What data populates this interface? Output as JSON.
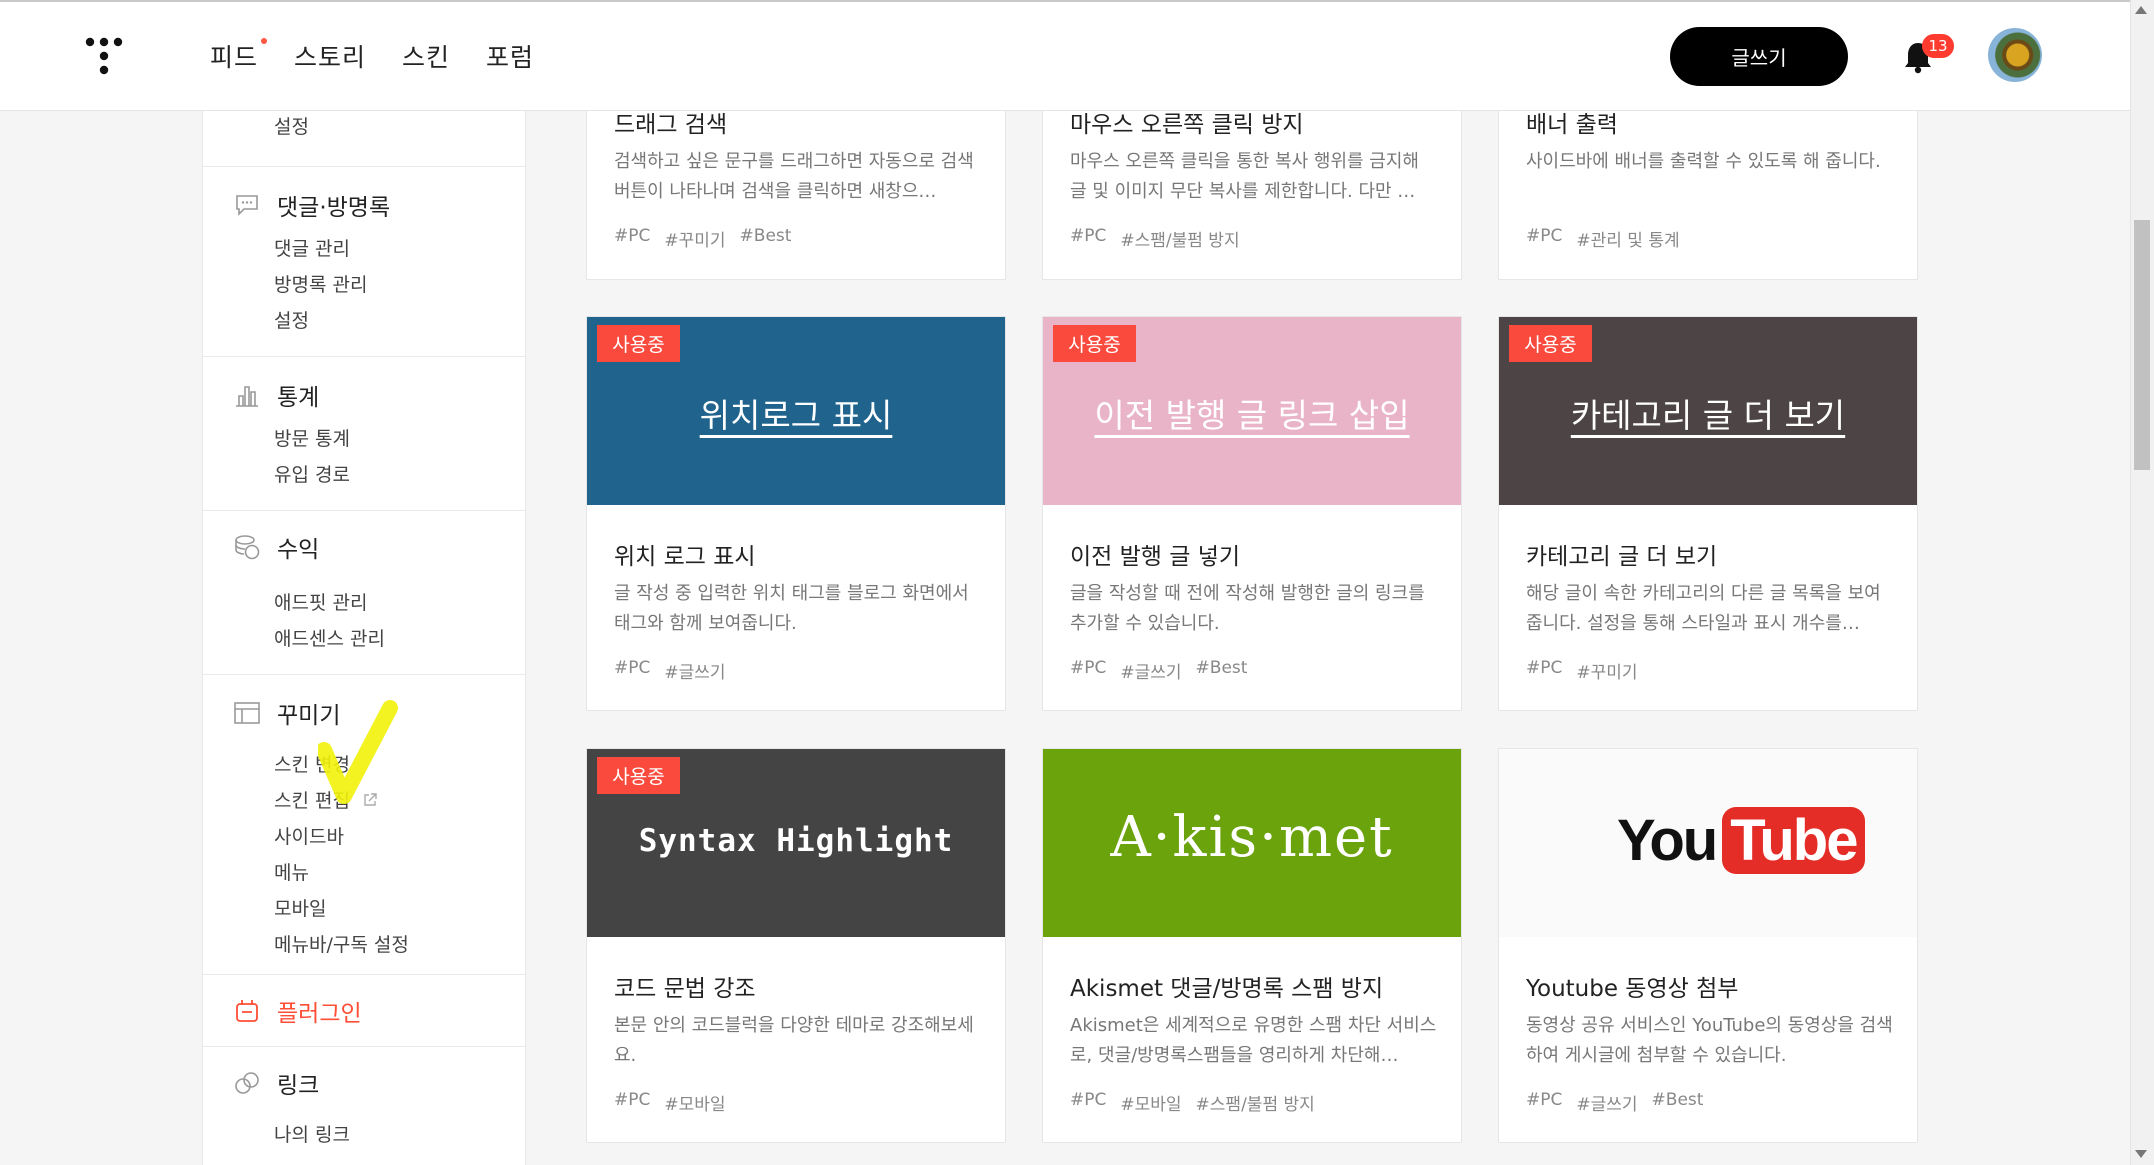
{
  "nav": {
    "items": [
      "피드",
      "스토리",
      "스킨",
      "포럼"
    ],
    "write_button": "글쓰기",
    "notification_count": "13"
  },
  "sidebar": {
    "top_item": "설정",
    "sections": [
      {
        "title": "댓글·방명록",
        "icon": "speech-bubble-icon",
        "items": [
          "댓글 관리",
          "방명록 관리",
          "설정"
        ]
      },
      {
        "title": "통계",
        "icon": "bar-chart-icon",
        "items": [
          "방문 통계",
          "유입 경로"
        ]
      },
      {
        "title": "수익",
        "icon": "coins-icon",
        "items": [
          "애드핏 관리",
          "애드센스 관리"
        ]
      },
      {
        "title": "꾸미기",
        "icon": "layout-icon",
        "items": [
          "스킨 변경",
          "스킨 편집",
          "사이드바",
          "메뉴",
          "모바일",
          "메뉴바/구독 설정"
        ]
      },
      {
        "title": "플러그인",
        "icon": "plugin-icon",
        "items": []
      },
      {
        "title": "링크",
        "icon": "link-icon",
        "items": [
          "나의 링크"
        ]
      }
    ]
  },
  "cards": [
    {
      "title": "드래그 검색",
      "desc": "검색하고 싶은 문구를 드래그하면 자동으로 검색 버튼이 나타나며 검색을 클릭하면 새창으…",
      "tags": [
        "#PC",
        "#꾸미기",
        "#Best"
      ]
    },
    {
      "title": "마우스 오른쪽 클릭 방지",
      "desc": "마우스 오른쪽 클릭을 통한 복사 행위를 금지해 글 및 이미지 무단 복사를 제한합니다. 다만 …",
      "tags": [
        "#PC",
        "#스팸/불펌 방지"
      ]
    },
    {
      "title": "배너 출력",
      "desc": "사이드바에 배너를 출력할 수 있도록 해 줍니다.",
      "tags": [
        "#PC",
        "#관리 및 통계"
      ]
    },
    {
      "badge": "사용중",
      "thumb_label": "위치로그 표시",
      "thumb_color": "#20648e",
      "title": "위치 로그 표시",
      "desc": "글 작성 중 입력한 위치 태그를 블로그 화면에서 태그와 함께 보여줍니다.",
      "tags": [
        "#PC",
        "#글쓰기"
      ]
    },
    {
      "badge": "사용중",
      "thumb_label": "이전 발행 글 링크 삽입",
      "thumb_color": "#eab4c8",
      "title": "이전 발행 글 넣기",
      "desc": "글을 작성할 때 전에 작성해 발행한 글의 링크를 추가할 수 있습니다.",
      "tags": [
        "#PC",
        "#글쓰기",
        "#Best"
      ]
    },
    {
      "badge": "사용중",
      "thumb_label": "카테고리 글 더 보기",
      "thumb_color": "#4d4545",
      "title": "카테고리 글 더 보기",
      "desc": "해당 글이 속한 카테고리의 다른 글 목록을 보여줍니다. 설정을 통해 스타일과 표시 개수를…",
      "tags": [
        "#PC",
        "#꾸미기"
      ]
    },
    {
      "badge": "사용중",
      "thumb_label": "Syntax Highlight",
      "thumb_color": "#444444",
      "title": "코드 문법 강조",
      "desc": "본문 안의 코드블럭을 다양한 테마로 강조해보세요.",
      "tags": [
        "#PC",
        "#모바일"
      ]
    },
    {
      "thumb_label": "A·kis·met",
      "thumb_color": "#6aa30c",
      "title": "Akismet 댓글/방명록 스팸 방지",
      "desc": "Akismet은 세계적으로 유명한 스팸 차단 서비스로, 댓글/방명록스팸들을 영리하게 차단해…",
      "tags": [
        "#PC",
        "#모바일",
        "#스팸/불펌 방지"
      ]
    },
    {
      "thumb_label": "You Tube",
      "thumb_color": "#fafafa",
      "title": "Youtube 동영상 첨부",
      "desc": "동영상 공유 서비스인 YouTube의 동영상을 검색하여 게시글에 첨부할 수 있습니다.",
      "tags": [
        "#PC",
        "#글쓰기",
        "#Best"
      ]
    }
  ]
}
